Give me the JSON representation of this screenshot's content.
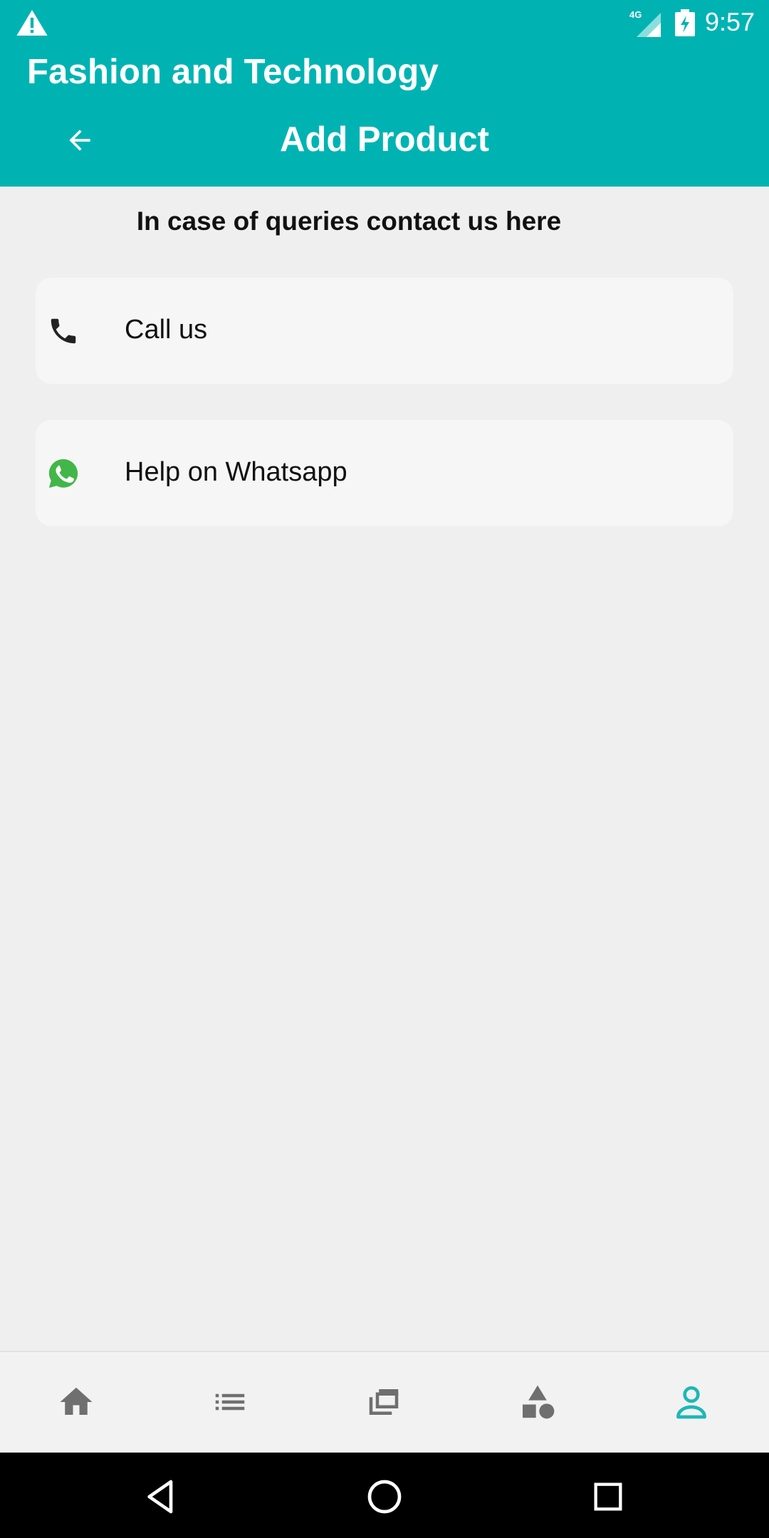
{
  "status_bar": {
    "time": "9:57",
    "network_label": "4G",
    "icons": [
      "warning-icon",
      "signal-icon",
      "battery-charging-icon"
    ]
  },
  "app_bar": {
    "app_title": "Fashion and Technology",
    "page_title": "Add Product",
    "back_icon": "arrow-back-icon"
  },
  "content": {
    "heading": "In case of queries contact us here",
    "options": [
      {
        "label": "Call us",
        "icon": "phone-icon"
      },
      {
        "label": "Help on Whatsapp",
        "icon": "whatsapp-icon"
      }
    ]
  },
  "bottom_nav": {
    "items": [
      {
        "icon": "home-icon",
        "active": false
      },
      {
        "icon": "list-icon",
        "active": false
      },
      {
        "icon": "gallery-icon",
        "active": false
      },
      {
        "icon": "categories-icon",
        "active": false
      },
      {
        "icon": "profile-icon",
        "active": true
      }
    ]
  },
  "colors": {
    "primary": "#00b3b3",
    "nav_inactive": "#6f6f6f",
    "nav_active": "#1eb7b7",
    "whatsapp": "#43b649"
  }
}
